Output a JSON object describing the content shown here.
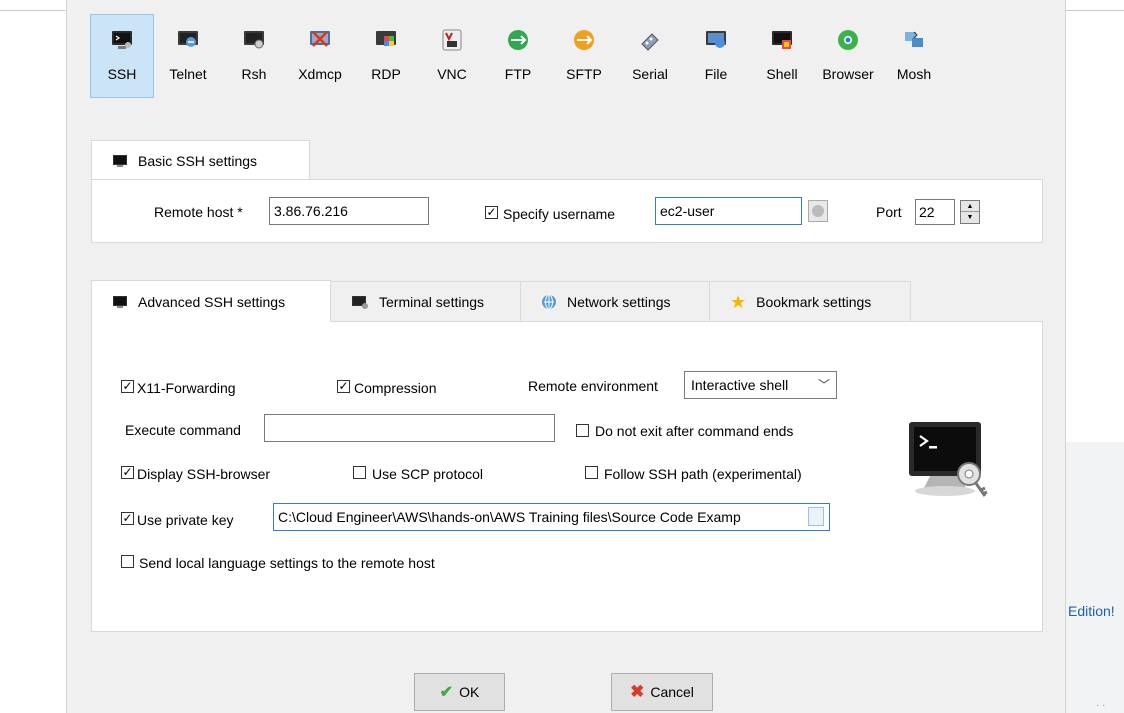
{
  "session_types": [
    {
      "label": "SSH",
      "icon": "ssh-icon",
      "selected": true
    },
    {
      "label": "Telnet",
      "icon": "telnet-icon"
    },
    {
      "label": "Rsh",
      "icon": "rsh-icon"
    },
    {
      "label": "Xdmcp",
      "icon": "xdmcp-icon"
    },
    {
      "label": "RDP",
      "icon": "rdp-icon"
    },
    {
      "label": "VNC",
      "icon": "vnc-icon"
    },
    {
      "label": "FTP",
      "icon": "ftp-icon"
    },
    {
      "label": "SFTP",
      "icon": "sftp-icon"
    },
    {
      "label": "Serial",
      "icon": "serial-icon"
    },
    {
      "label": "File",
      "icon": "file-icon"
    },
    {
      "label": "Shell",
      "icon": "shell-icon"
    },
    {
      "label": "Browser",
      "icon": "browser-icon"
    },
    {
      "label": "Mosh",
      "icon": "mosh-icon"
    }
  ],
  "basic": {
    "tab_label": "Basic SSH settings",
    "remote_host_label": "Remote host *",
    "remote_host_value": "3.86.76.216",
    "specify_username_label": "Specify username",
    "specify_username_checked": true,
    "username_value": "ec2-user",
    "port_label": "Port",
    "port_value": "22"
  },
  "advanced_tabs": [
    {
      "label": "Advanced SSH settings",
      "icon": "terminal-icon",
      "active": true
    },
    {
      "label": "Terminal settings",
      "icon": "terminal-settings-icon"
    },
    {
      "label": "Network settings",
      "icon": "network-icon"
    },
    {
      "label": "Bookmark settings",
      "icon": "star-icon"
    }
  ],
  "advanced": {
    "x11_forwarding": "X11-Forwarding",
    "compression": "Compression",
    "remote_environment_label": "Remote environment",
    "remote_environment_value": "Interactive shell",
    "execute_command_label": "Execute command",
    "execute_command_value": "",
    "do_not_exit": "Do not exit after command ends",
    "display_ssh_browser": "Display SSH-browser",
    "use_scp": "Use SCP protocol",
    "follow_ssh_path": "Follow SSH path (experimental)",
    "use_private_key": "Use private key",
    "private_key_path": "C:\\Cloud Engineer\\AWS\\hands-on\\AWS Training files\\Source Code Examp",
    "send_locale": "Send local language settings to the remote host"
  },
  "buttons": {
    "ok": "OK",
    "cancel": "Cancel"
  },
  "background": {
    "edition_text": "Edition!"
  },
  "colors": {
    "selected_bg": "#cce4f7",
    "focus_border": "#2f7fd0",
    "link": "#1f5fae"
  }
}
